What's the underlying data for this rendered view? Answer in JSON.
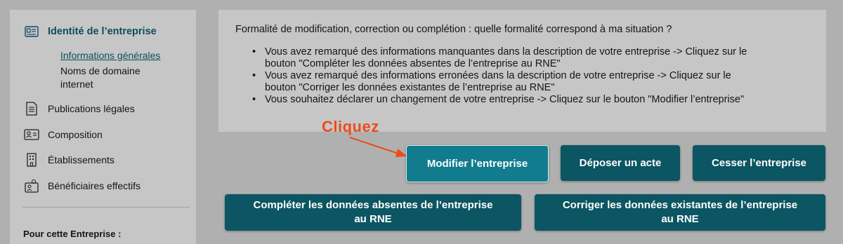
{
  "sidebar": {
    "items": [
      {
        "label": "Identité de l’entreprise",
        "icon": "id-card-icon"
      },
      {
        "label": "Publications légales",
        "icon": "document-icon"
      },
      {
        "label": "Composition",
        "icon": "people-card-icon"
      },
      {
        "label": "Établissements",
        "icon": "building-icon"
      },
      {
        "label": "Bénéficiaires effectifs",
        "icon": "person-card-icon"
      }
    ],
    "subitems": [
      "Informations générales",
      "Noms de domaine",
      "internet"
    ],
    "footer": "Pour cette Entreprise :"
  },
  "info": {
    "question": "Formalité de modification, correction ou complétion : quelle formalité correspond à ma situation ?",
    "bullets": [
      {
        "line1": "Vous avez remarqué des informations manquantes dans la description de votre entreprise -> Cliquez sur le",
        "line2": "bouton \"Compléter les données absentes de l’entreprise au RNE\""
      },
      {
        "line1": "Vous avez remarqué des informations erronées dans la description de votre entreprise -> Cliquez sur le",
        "line2": "bouton \"Corriger les données existantes de l’entreprise au RNE\""
      },
      {
        "line1": "Vous souhaitez déclarer un changement de votre entreprise -> Cliquez sur le bouton \"Modifier l’entreprise\"",
        "line2": ""
      }
    ]
  },
  "annotation": {
    "text": "Cliquez",
    "color": "#ee4a1c"
  },
  "buttons": {
    "modify": "Modifier l’entreprise",
    "deposit": "Déposer un acte",
    "cease": "Cesser l’entreprise",
    "complete_line1": "Compléter les données absentes de l’entreprise",
    "complete_line2": "au RNE",
    "correct_line1": "Corriger les données existantes de l’entreprise",
    "correct_line2": "au RNE"
  },
  "colors": {
    "accent": "#0c5563",
    "highlight": "#107c8e",
    "active_text": "#0b4f5c"
  }
}
